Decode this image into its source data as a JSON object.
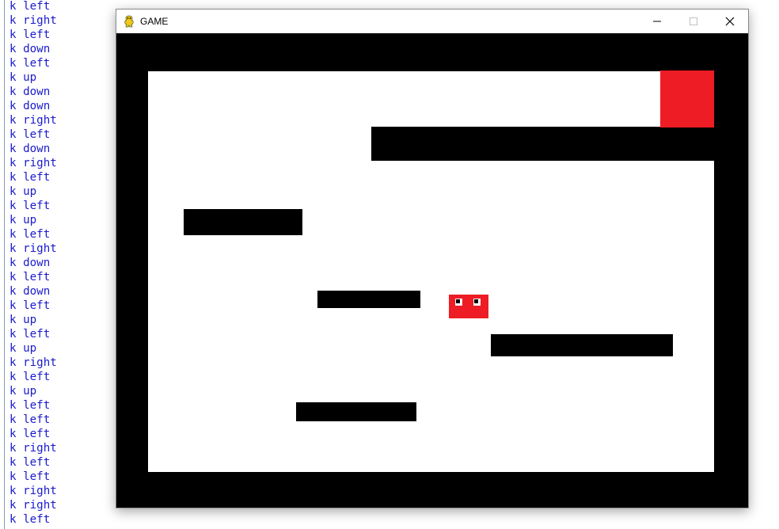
{
  "console": {
    "lines": [
      "k left",
      "k right",
      "k left",
      "k down",
      "k left",
      "k up",
      "k down",
      "k down",
      "k right",
      "k left",
      "k down",
      "k right",
      "k left",
      "k up",
      "k left",
      "k up",
      "k left",
      "k right",
      "k down",
      "k left",
      "k down",
      "k left",
      "k up",
      "k left",
      "k up",
      "k right",
      "k left",
      "k up",
      "k left",
      "k left",
      "k left",
      "k right",
      "k left",
      "k left",
      "k right",
      "k right",
      "k left"
    ]
  },
  "window": {
    "title": "GAME",
    "icon": "pygame-snake-icon",
    "controls": [
      "minimize-icon",
      "maximize-icon",
      "close-icon"
    ]
  },
  "game": {
    "background_color": "#000000",
    "arena_color": "#ffffff",
    "wall_color": "#000000",
    "goal_color": "#ee1c25",
    "player_color": "#ee1c25"
  }
}
